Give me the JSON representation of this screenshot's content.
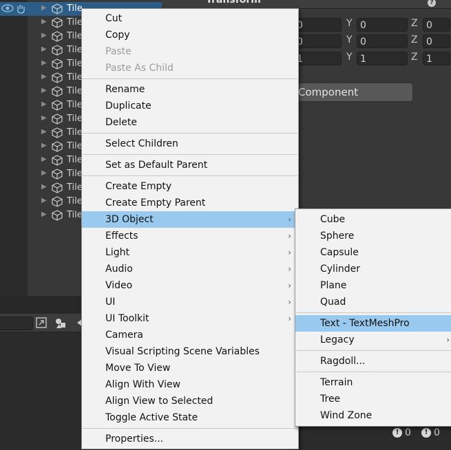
{
  "hierarchy": {
    "item_label": "Tile",
    "items": [
      "Tile",
      "Tile",
      "Tile",
      "Tile",
      "Tile",
      "Tile",
      "Tile",
      "Tile",
      "Tile",
      "Tile",
      "Tile",
      "Tile",
      "Tile",
      "Tile",
      "Tile",
      "Tile"
    ]
  },
  "inspector": {
    "component_title": "Transform",
    "rows": [
      {
        "x": "0",
        "y": "0",
        "z": "0"
      },
      {
        "x": "0",
        "y": "0",
        "z": "0"
      },
      {
        "x": "1",
        "y": "1",
        "z": "1"
      }
    ],
    "axis_labels": {
      "y": "Y",
      "z": "Z"
    },
    "add_component_label": "Component"
  },
  "bottom": {
    "errors_count": "0",
    "warnings_count": "0"
  },
  "context_menu": {
    "groups": [
      [
        {
          "label": "Cut",
          "enabled": true
        },
        {
          "label": "Copy",
          "enabled": true
        },
        {
          "label": "Paste",
          "enabled": false
        },
        {
          "label": "Paste As Child",
          "enabled": false
        }
      ],
      [
        {
          "label": "Rename",
          "enabled": true
        },
        {
          "label": "Duplicate",
          "enabled": true
        },
        {
          "label": "Delete",
          "enabled": true
        }
      ],
      [
        {
          "label": "Select Children",
          "enabled": true
        }
      ],
      [
        {
          "label": "Set as Default Parent",
          "enabled": true
        }
      ],
      [
        {
          "label": "Create Empty",
          "enabled": true
        },
        {
          "label": "Create Empty Parent",
          "enabled": true
        },
        {
          "label": "3D Object",
          "enabled": true,
          "submenu": true,
          "highlighted": true
        },
        {
          "label": "Effects",
          "enabled": true,
          "submenu": true
        },
        {
          "label": "Light",
          "enabled": true,
          "submenu": true
        },
        {
          "label": "Audio",
          "enabled": true,
          "submenu": true
        },
        {
          "label": "Video",
          "enabled": true,
          "submenu": true
        },
        {
          "label": "UI",
          "enabled": true,
          "submenu": true
        },
        {
          "label": "UI Toolkit",
          "enabled": true,
          "submenu": true
        },
        {
          "label": "Camera",
          "enabled": true
        },
        {
          "label": "Visual Scripting Scene Variables",
          "enabled": true
        },
        {
          "label": "Move To View",
          "enabled": true
        },
        {
          "label": "Align With View",
          "enabled": true
        },
        {
          "label": "Align View to Selected",
          "enabled": true
        },
        {
          "label": "Toggle Active State",
          "enabled": true
        }
      ],
      [
        {
          "label": "Properties...",
          "enabled": true
        }
      ]
    ]
  },
  "submenu_3d_object": {
    "groups": [
      [
        {
          "label": "Cube"
        },
        {
          "label": "Sphere"
        },
        {
          "label": "Capsule"
        },
        {
          "label": "Cylinder"
        },
        {
          "label": "Plane"
        },
        {
          "label": "Quad"
        }
      ],
      [
        {
          "label": "Text - TextMeshPro",
          "highlighted": true
        },
        {
          "label": "Legacy",
          "submenu": true
        }
      ],
      [
        {
          "label": "Ragdoll..."
        }
      ],
      [
        {
          "label": "Terrain"
        },
        {
          "label": "Tree"
        },
        {
          "label": "Wind Zone"
        }
      ]
    ]
  },
  "icons": {
    "visibility": "eye-icon",
    "pickable": "hand-icon",
    "gameobject": "cube-icon",
    "expand": "triangle-right-icon",
    "submenu": "chevron-right-icon",
    "help": "help-icon",
    "error": "error-icon",
    "warning": "warning-icon"
  },
  "colors": {
    "selection": "#2c5d87",
    "menu_highlight": "#99c9ef",
    "menu_bg": "#f2f2f2",
    "editor_bg": "#383838"
  }
}
